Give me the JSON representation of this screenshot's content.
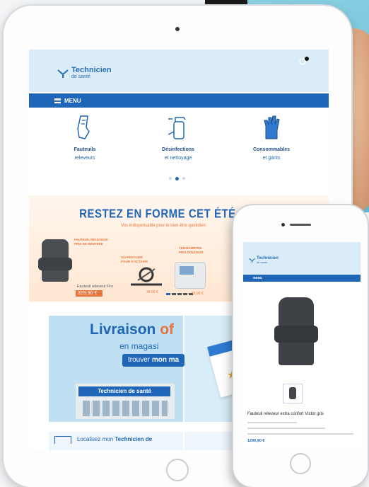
{
  "tablet": {
    "logo": {
      "name": "Technicien",
      "sub": "de santé"
    },
    "menu_label": "MENU",
    "categories": [
      {
        "title": "Fauteuils",
        "subtitle": "releveurs",
        "icon": "hand-wash-icon"
      },
      {
        "title": "Désinfections",
        "subtitle": "et nettoyage",
        "icon": "spray-bottle-icon"
      },
      {
        "title": "Consommables",
        "subtitle": "et gants",
        "icon": "glove-icon"
      }
    ],
    "promo": {
      "title": "RESTEZ EN FORME CET ÉTÉ !",
      "subtitle": "Vos indispensable pour le bien-être quotidien",
      "chair_tag": "FAUTEUIL RELEVEUR\nPRIX DE RENTRÉE",
      "bike_tag": "OÙ PÉDALIER\nPOUR S'ACTIVER",
      "bp_tag": "TENSIOMÈTRE\nPRIX DOUCEUR",
      "product_name": "Fauteuil releveur Pro",
      "product_price": "329,90 €",
      "bike_price": "34,90 €",
      "bp_price": "29,90 €"
    },
    "livraison": {
      "title": "Livraison",
      "title_accent": "of",
      "subtitle": "en magasi",
      "button_prefix": "trouver",
      "button_bold": "mon ma",
      "store_sign": "Technicien de santé"
    },
    "locate": {
      "prefix": "Localisez mon",
      "bold": "Technicien de"
    }
  },
  "phone": {
    "logo": {
      "name": "Technicien",
      "sub": "de santé"
    },
    "menu_label": "MENU",
    "product_name": "Fauteuil releveur extra confort Victor gris",
    "price": "1299,90 €"
  },
  "colors": {
    "primary": "#1f66b8",
    "accent": "#e9743b",
    "header_bg": "#d9ecf8"
  }
}
